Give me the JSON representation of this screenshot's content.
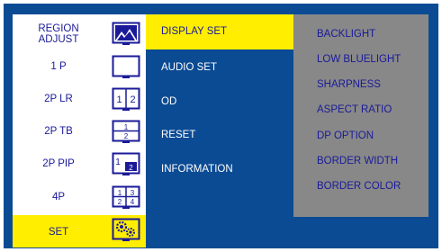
{
  "colors": {
    "frame_blue": "#0b4b94",
    "highlight_yellow": "#ffee00",
    "panel_gray": "#888888",
    "text_navy": "#1a1a99",
    "text_white": "#ffffff"
  },
  "left_menu": {
    "items": [
      {
        "label_line1": "REGION",
        "label_line2": "ADJUST",
        "icon": "region-adjust-icon"
      },
      {
        "label": "1 P",
        "icon": "single-monitor-icon"
      },
      {
        "label": "2P LR",
        "icon": "split-left-right-icon",
        "icon_text": [
          "1",
          "2"
        ]
      },
      {
        "label": "2P TB",
        "icon": "split-top-bottom-icon",
        "icon_text": [
          "1",
          "2"
        ]
      },
      {
        "label": "2P PIP",
        "icon": "picture-in-picture-icon",
        "icon_text": [
          "1",
          "2"
        ]
      },
      {
        "label": "4P",
        "icon": "quad-split-icon",
        "icon_text": [
          "1",
          "3",
          "2",
          "4"
        ]
      },
      {
        "label": "SET",
        "icon": "settings-gears-icon",
        "selected": true
      }
    ]
  },
  "middle_menu": {
    "items": [
      {
        "label": "DISPLAY SET",
        "selected": true
      },
      {
        "label": "AUDIO SET"
      },
      {
        "label": "OD"
      },
      {
        "label": "RESET"
      },
      {
        "label": "INFORMATION"
      }
    ]
  },
  "right_menu": {
    "items": [
      {
        "label": "BACKLIGHT"
      },
      {
        "label": "LOW BLUELIGHT"
      },
      {
        "label": "SHARPNESS"
      },
      {
        "label": "ASPECT RATIO"
      },
      {
        "label": "DP OPTION"
      },
      {
        "label": "BORDER WIDTH"
      },
      {
        "label": "BORDER COLOR"
      }
    ]
  }
}
